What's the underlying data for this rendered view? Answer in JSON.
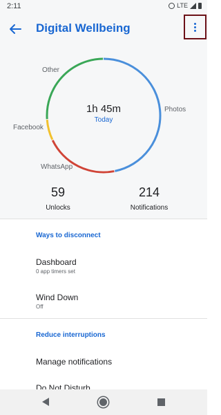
{
  "status_bar": {
    "time": "2:11",
    "network": "LTE"
  },
  "app_bar": {
    "title": "Digital Wellbeing",
    "accent": "#1967d2"
  },
  "chart_data": {
    "type": "pie",
    "style": "donut",
    "total_label": "1h 45m",
    "period_label": "Today",
    "slices": [
      {
        "name": "Photos",
        "share": 0.47,
        "color": "#4a8fdb"
      },
      {
        "name": "WhatsApp",
        "share": 0.21,
        "color": "#d04437"
      },
      {
        "name": "Facebook",
        "share": 0.06,
        "color": "#f2c12e"
      },
      {
        "name": "Other",
        "share": 0.26,
        "color": "#3aa757"
      }
    ]
  },
  "stats": {
    "unlocks": {
      "value": "59",
      "label": "Unlocks"
    },
    "notifications": {
      "value": "214",
      "label": "Notifications"
    }
  },
  "sections": {
    "disconnect": {
      "header": "Ways to disconnect",
      "items": [
        {
          "title": "Dashboard",
          "subtitle": "0 app timers set"
        },
        {
          "title": "Wind Down",
          "subtitle": "Off"
        }
      ]
    },
    "interruptions": {
      "header": "Reduce interruptions",
      "items": [
        {
          "title": "Manage notifications"
        },
        {
          "title": "Do Not Disturb"
        }
      ]
    }
  }
}
